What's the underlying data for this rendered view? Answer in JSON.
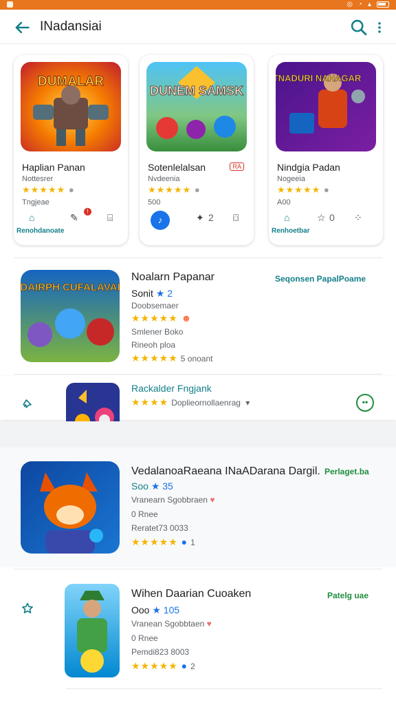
{
  "app_title": "INadansiai",
  "top_cards": [
    {
      "art_title": "DUMALAR",
      "name": "Haplian Panan",
      "sub": "Nottesrer",
      "extra": "Tngjeae",
      "stars": "★★★★★",
      "action_label": "Renohdanoate"
    },
    {
      "art_title": "DUNEM SAMSK",
      "name": "Sotenlelalsan",
      "badge": "RA",
      "sub": "Nvdeenia",
      "extra": "500",
      "stars": "★★★★★",
      "action_count": "2"
    },
    {
      "art_title": "TNADURI NAHAGAR",
      "name": "Nindgia Padan",
      "sub": "Nogeeia",
      "extra": "A00",
      "stars": "★★★★★",
      "action_count": "0",
      "action_label": "Renhoetbar"
    }
  ],
  "list_rows": [
    {
      "art_title": "DAIRPH CUFALAVAI",
      "name": "Noalarn Papanar",
      "link": "Seqonsen  PapalPoame",
      "line1": "Sonit",
      "line1_extra": "★ 2",
      "line2": "Doobsemaer",
      "stars": "★★★★★",
      "line3": "Smlener Boko",
      "line4": "Rineoh ploa",
      "stars2": "★★★★★",
      "stats2": "5 onoant"
    },
    {
      "name": "Rackalder Fngjank",
      "stars": "★★★★",
      "meta": "Doplieornollaenrag"
    },
    {
      "name": "VedalanoaRaeana INaADarana Dargil.",
      "link": "Perlaget.ba",
      "line1": "Soo",
      "line1_extra": "★ 35",
      "line2": "Vranearn Sgobbraen",
      "line3": "0 Rnee",
      "line4": "Reratet73 0033",
      "stars": "★★★★★",
      "stats": "1"
    },
    {
      "name": "Wihen Daarian Cuoaken",
      "link": "Patelg uae",
      "line1": "Ooo",
      "line1_extra": "★ 105",
      "line2": "Vranean Sgobbtaen",
      "line3": "0 Rnee",
      "line4": "Pemdi823 8003",
      "stars": "★★★★★",
      "stats": "2"
    }
  ],
  "colors": {
    "status_bar": "#e8761e",
    "accent": "#137f8a",
    "star": "#f4b400",
    "green": "#1e8e3e"
  }
}
